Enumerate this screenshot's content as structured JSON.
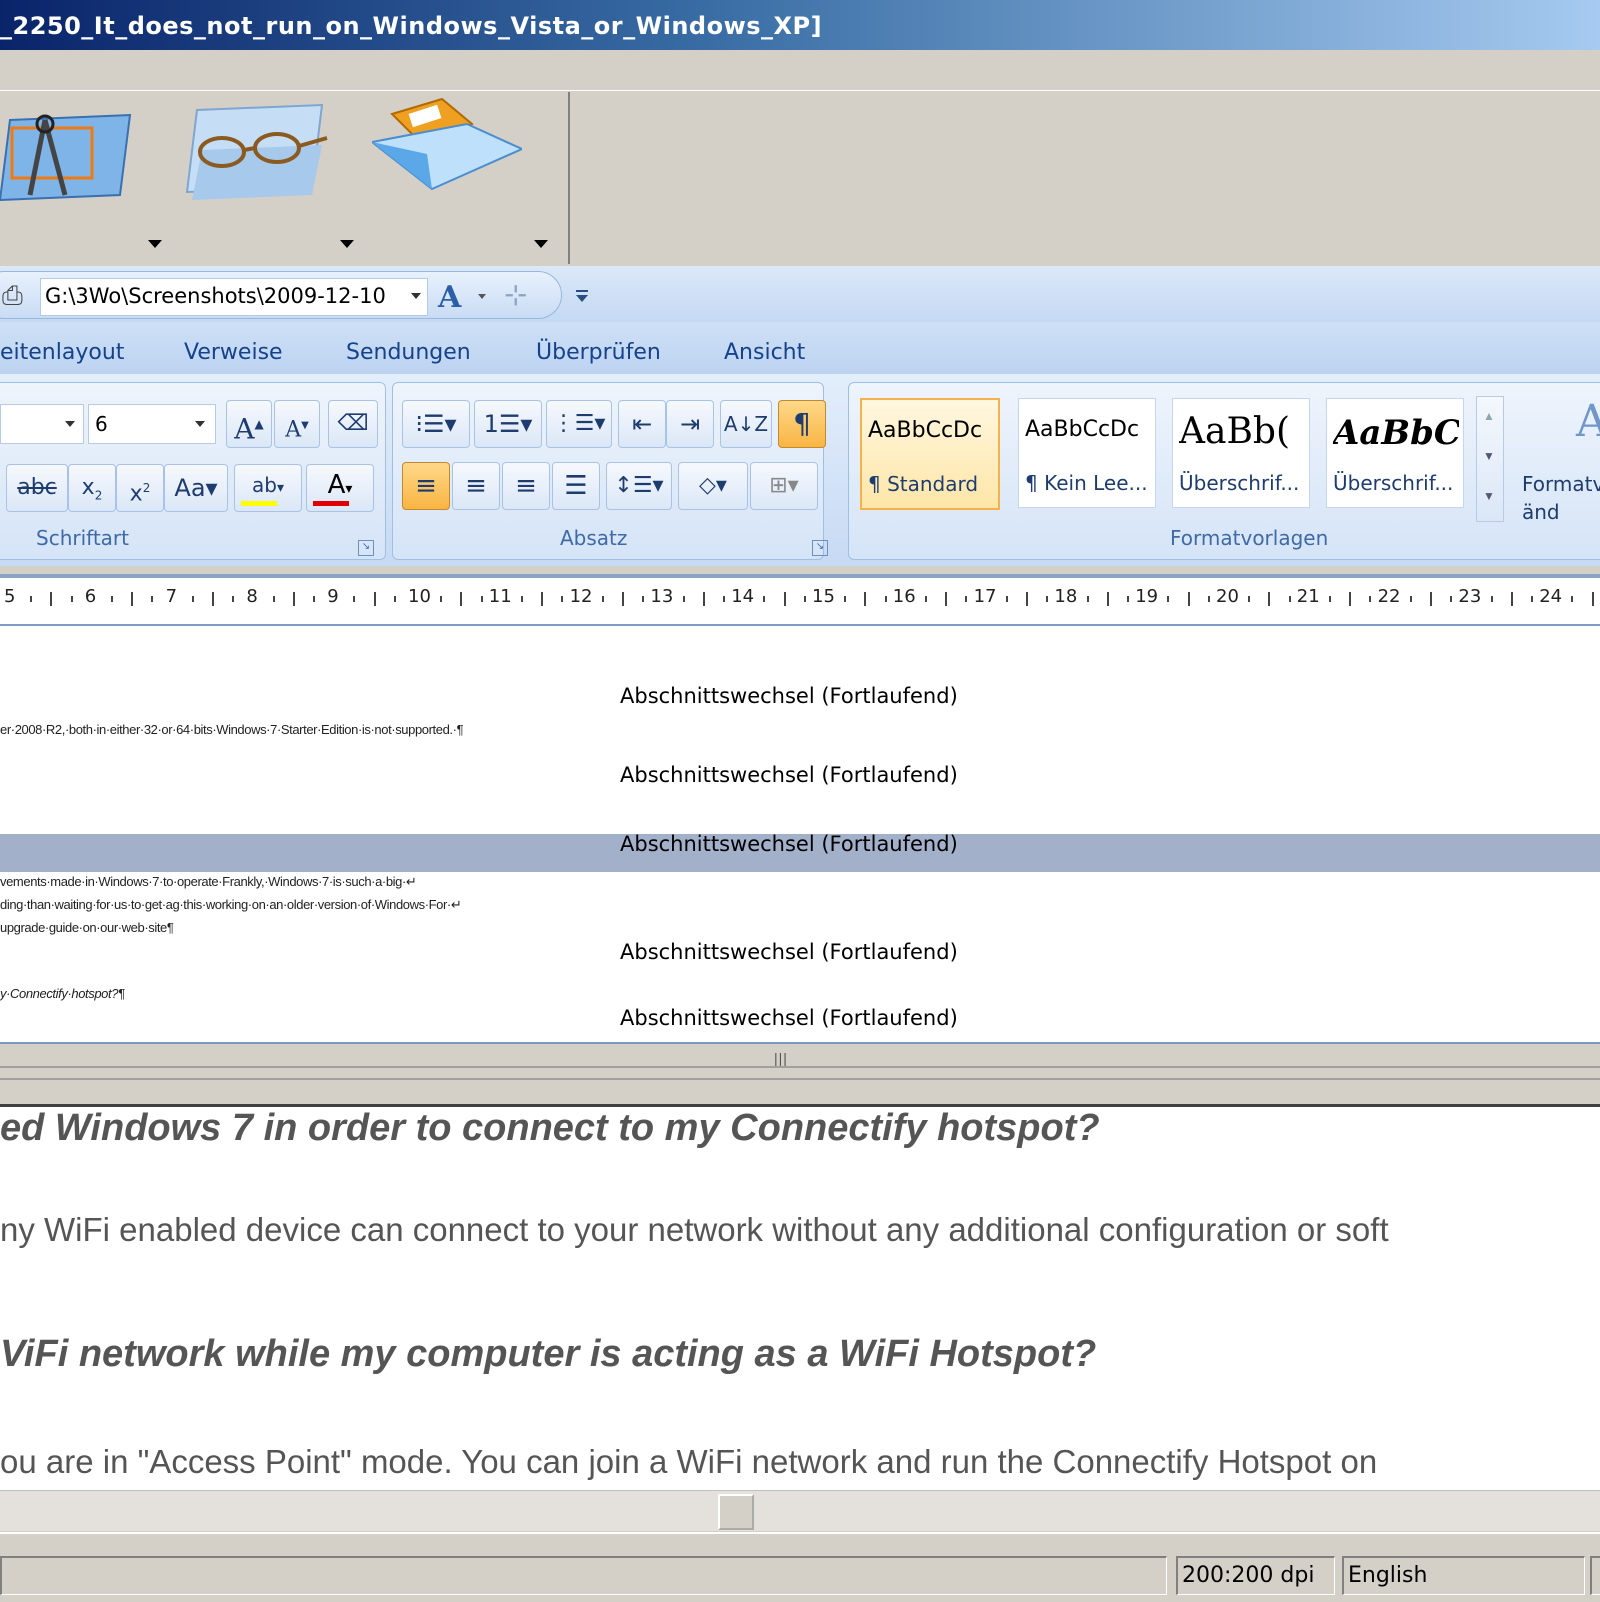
{
  "window": {
    "title": "_2250_It_does_not_run_on_Windows_Vista_or_Windows_XP]"
  },
  "quick_access": {
    "path": "G:\\3Wo\\Screenshots\\2009-12-10"
  },
  "ribbon": {
    "tabs": [
      "eitenlayout",
      "Verweise",
      "Sendungen",
      "Überprüfen",
      "Ansicht"
    ],
    "font_size_value": "6",
    "groups": {
      "font": "Schriftart",
      "paragraph": "Absatz",
      "styles": "Formatvorlagen"
    },
    "styles": [
      {
        "sample": "AaBbCcDc",
        "name": "¶ Standard"
      },
      {
        "sample": "AaBbCcDc",
        "name": "¶ Kein Lee..."
      },
      {
        "sample": "AaBb(",
        "name": "Überschrif..."
      },
      {
        "sample": "AaBbC",
        "name": "Überschrif..."
      }
    ],
    "change_styles_label": "Formatv änd"
  },
  "ruler": {
    "numbers": [
      "5",
      "6",
      "7",
      "8",
      "9",
      "10",
      "11",
      "12",
      "13",
      "14",
      "15",
      "16",
      "17",
      "18",
      "19",
      "20",
      "21",
      "22",
      "23",
      "24"
    ]
  },
  "document": {
    "section_breaks": [
      "Abschnittswechsel (Fortlaufend)",
      "Abschnittswechsel (Fortlaufend)",
      "Abschnittswechsel (Fortlaufend)",
      "Abschnittswechsel (Fortlaufend)",
      "Abschnittswechsel (Fortlaufend)"
    ],
    "small_lines": [
      "er·2008·R2,·both·in·either·32·or·64·bits·Windows·7·Starter·Edition·is·not·supported.·¶",
      "vements·made·in·Windows·7·to·operate·Frankly,·Windows·7·is·such·a·big·↵",
      "ding·than·waiting·for·us·to·get·ag·this·working·on·an·older·version·of·Windows·For·↵",
      "upgrade·guide·on·our·web·site¶",
      "y·Connectify·hotspot?¶"
    ]
  },
  "lower_document": {
    "lines": [
      "ed Windows 7 in order to connect to my Connectify hotspot?",
      "ny WiFi enabled device can connect to your network without any additional configuration or soft",
      "ViFi network while my computer is acting as a WiFi Hotspot?",
      "ou are in \"Access Point\" mode. You can join a WiFi network and run the Connectify Hotspot on"
    ]
  },
  "status": {
    "dpi": "200:200 dpi",
    "language": "English"
  }
}
